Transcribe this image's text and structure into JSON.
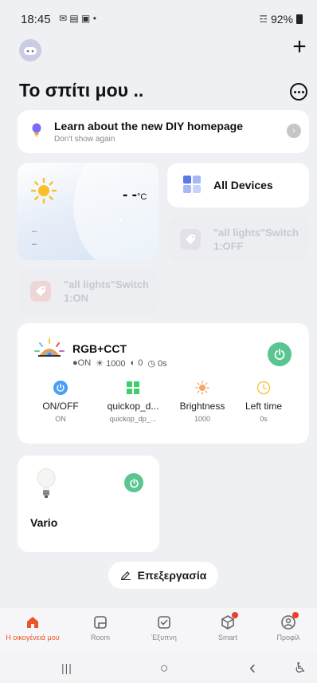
{
  "status_bar": {
    "time": "18:45",
    "notif_icons": "✉ ▤ ▣ •",
    "signal": "☲",
    "battery": "92%"
  },
  "header": {
    "title": "Το σπίτι μου ..",
    "add_glyph": "+"
  },
  "banner": {
    "title": "Learn about the new DIY homepage",
    "subtitle": "Don't show again",
    "arrow": "›"
  },
  "weather": {
    "temperature": "- -",
    "unit": "°C",
    "line1": "–",
    "line2": "–"
  },
  "all_devices": {
    "label": "All Devices"
  },
  "scenes": [
    {
      "label": "\"all lights\"Switch 1:OFF"
    },
    {
      "label": "\"all lights\"Switch 1:ON"
    }
  ],
  "rgb_device": {
    "name": "RGB+CCT",
    "status": [
      "●ON",
      "☀ 1000",
      "◐ 0",
      "◷ 0s"
    ],
    "controls": [
      {
        "label": "ON/OFF",
        "value": "ON",
        "icon": "power-icon",
        "color": "#4a9ff5"
      },
      {
        "label": "quickop_d...",
        "value": "quickop_dp_...",
        "icon": "grid-icon",
        "color": "#3ecf6b"
      },
      {
        "label": "Brightness",
        "value": "1000",
        "icon": "sun-icon",
        "color": "#f3a76b"
      },
      {
        "label": "Left time",
        "value": "0s",
        "icon": "clock-icon",
        "color": "#f3c84b"
      }
    ]
  },
  "vario_device": {
    "name": "Vario"
  },
  "edit": {
    "label": "Επεξεργασία"
  },
  "bottom_nav": [
    {
      "label": "Η οικογένειά μου",
      "icon": "home-icon",
      "active": true
    },
    {
      "label": "Room",
      "icon": "room-icon",
      "active": false
    },
    {
      "label": "Έξυπνη",
      "icon": "smart-check-icon",
      "active": false
    },
    {
      "label": "Smart",
      "icon": "cube-icon",
      "active": false
    },
    {
      "label": "Προφίλ",
      "icon": "profile-icon",
      "active": false
    }
  ],
  "system_nav": {
    "recents": "|||",
    "home": "○",
    "back": "‹",
    "accessibility": "♿"
  },
  "colors": {
    "accent": "#e8572a",
    "power_green": "#59c692",
    "background": "#eef0f3"
  }
}
